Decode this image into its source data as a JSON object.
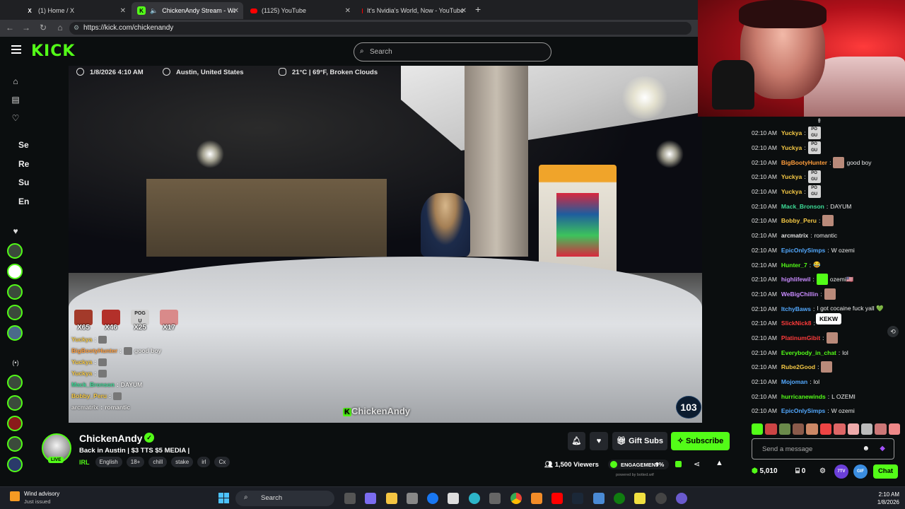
{
  "browser": {
    "tabs": [
      {
        "label": "(1) Home / X",
        "icon": "x-icon"
      },
      {
        "label": "ChickenAndy Stream - Watch",
        "icon": "kick-icon"
      },
      {
        "label": "(1125) YouTube",
        "icon": "youtube-icon"
      },
      {
        "label": "It's Nvidia's World, Now - YouTube",
        "icon": "youtube-icon"
      }
    ],
    "url": "https://kick.com/chickenandy"
  },
  "header": {
    "logo": "KICK",
    "search_placeholder": "Search"
  },
  "sidebar": {
    "labels": [
      "Se",
      "Re",
      "Su",
      "En"
    ]
  },
  "video": {
    "date": "1/8/2026 4:10 AM",
    "location": "Austin, United States",
    "weather": "21°C | 69°F, Broken Clouds",
    "emote_counts": [
      "X65",
      "X46",
      "X25",
      "X17"
    ],
    "watermark": "ChickenAndy",
    "viewer_badge": "103",
    "overlay_chat": [
      {
        "user": "Yuckya",
        "color": "#f6c945",
        "msg": ""
      },
      {
        "user": "BigBootyHunter",
        "color": "#ff9d3b",
        "msg": "good boy"
      },
      {
        "user": "Yuckya",
        "color": "#f6c945",
        "msg": ""
      },
      {
        "user": "Yuckya",
        "color": "#f6c945",
        "msg": ""
      },
      {
        "user": "Mack_Bronson",
        "color": "#3ddc97",
        "msg": "DAYUM"
      },
      {
        "user": "Bobby_Peru",
        "color": "#f6c945",
        "msg": ""
      },
      {
        "user": "arcmatrix",
        "color": "#e0e0e0",
        "msg": "romantic"
      }
    ]
  },
  "chat": {
    "messages": [
      {
        "time": "02:10 AM",
        "user": "Yuckya",
        "color": "#f6c945",
        "msg": "",
        "emote": "pogu"
      },
      {
        "time": "02:10 AM",
        "user": "Yuckya",
        "color": "#f6c945",
        "msg": "",
        "emote": "pogu"
      },
      {
        "time": "02:10 AM",
        "user": "BigBootyHunter",
        "color": "#ff9d3b",
        "msg": "good boy",
        "emote": "img"
      },
      {
        "time": "02:10 AM",
        "user": "Yuckya",
        "color": "#f6c945",
        "msg": "",
        "emote": "pogu"
      },
      {
        "time": "02:10 AM",
        "user": "Yuckya",
        "color": "#f6c945",
        "msg": "",
        "emote": "pogu"
      },
      {
        "time": "02:10 AM",
        "user": "Mack_Bronson",
        "color": "#3ddc97",
        "msg": "DAYUM",
        "emote": ""
      },
      {
        "time": "02:10 AM",
        "user": "Bobby_Peru",
        "color": "#f6c945",
        "msg": "",
        "emote": "img"
      },
      {
        "time": "02:10 AM",
        "user": "arcmatrix",
        "color": "#e0e0e0",
        "msg": "romantic",
        "emote": ""
      },
      {
        "time": "02:10 AM",
        "user": "EpicOnlySimps",
        "color": "#53a9ff",
        "msg": "W ozemi",
        "emote": ""
      },
      {
        "time": "02:10 AM",
        "user": "Hunter_7",
        "color": "#53fc18",
        "msg": "😂",
        "emote": ""
      },
      {
        "time": "02:10 AM",
        "user": "highlifewil",
        "color": "#c98bff",
        "msg": "ozemi🇺🇸",
        "emote": "w"
      },
      {
        "time": "02:10 AM",
        "user": "WeBigChillin",
        "color": "#c98bff",
        "msg": "",
        "emote": "img"
      },
      {
        "time": "02:10 AM",
        "user": "ItchyBaws",
        "color": "#53a9ff",
        "msg": "I got cocaine fuck yall 💚",
        "emote": ""
      },
      {
        "time": "02:10 AM",
        "user": "SlickNick8",
        "color": "#ff3b3b",
        "msg": "",
        "emote": ""
      },
      {
        "time": "02:10 AM",
        "user": "PlatinumGibit",
        "color": "#ff3b3b",
        "msg": "",
        "emote": "img"
      },
      {
        "time": "02:10 AM",
        "user": "Everybody_in_chat",
        "color": "#53fc18",
        "msg": "lol",
        "emote": ""
      },
      {
        "time": "02:10 AM",
        "user": "Rube2Good",
        "color": "#f6c945",
        "msg": "",
        "emote": "img"
      },
      {
        "time": "02:10 AM",
        "user": "Mojoman",
        "color": "#53a9ff",
        "msg": "lol",
        "emote": ""
      },
      {
        "time": "02:10 AM",
        "user": "hurricanewinds",
        "color": "#53fc18",
        "msg": "L OZEMI",
        "emote": ""
      },
      {
        "time": "02:10 AM",
        "user": "EpicOnlySimps",
        "color": "#53a9ff",
        "msg": "W ozemi",
        "emote": ""
      }
    ],
    "tooltip": "KEKW",
    "input_placeholder": "Send a message",
    "points": "5,010",
    "zero_count": "0",
    "badge_7tv": "7TV",
    "badge_gif": "GIF",
    "send_label": "Chat"
  },
  "channel": {
    "name": "ChickenAndy",
    "live": "LIVE",
    "title": "Back in Austin | $3 TTS $5 MEDIA |",
    "category": "IRL",
    "tags": [
      "English",
      "18+",
      "chill",
      "stake",
      "irl",
      "Cx"
    ],
    "gift_label": "Gift Subs",
    "subscribe_label": "Subscribe",
    "viewers": "1,500 Viewers",
    "engagement_label": "ENGAGEMENT",
    "engagement_value": "9%",
    "powered_by": "powered by botted.wtf"
  },
  "taskbar": {
    "weather_title": "Wind advisory",
    "weather_sub": "Just issued",
    "search": "Search",
    "time": "2:10 AM",
    "date": "1/8/2026"
  }
}
